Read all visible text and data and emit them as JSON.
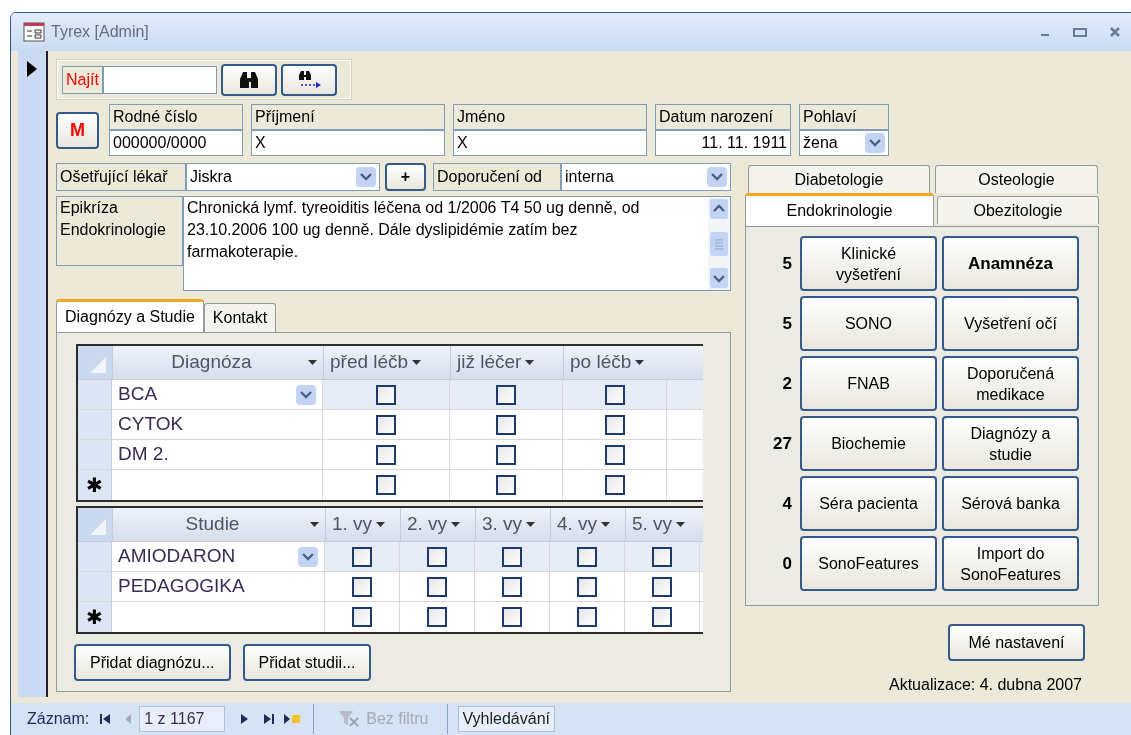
{
  "window": {
    "title": "Tyrex [Admin]"
  },
  "find": {
    "label": "Najít"
  },
  "m_button": {
    "label": "M"
  },
  "patient_fields": [
    {
      "label": "Rodné číslo",
      "value": "000000/0000",
      "kind": "text"
    },
    {
      "label": "Příjmení",
      "value": "X",
      "kind": "text"
    },
    {
      "label": "Jméno",
      "value": "X",
      "kind": "text"
    },
    {
      "label": "Datum narození",
      "value": "11. 11. 1911",
      "kind": "date"
    },
    {
      "label": "Pohlaví",
      "value": "žena",
      "kind": "combo"
    }
  ],
  "doctor": {
    "label": "Ošetřující lékař",
    "value": "Jiskra"
  },
  "plus_button": {
    "label": "+"
  },
  "referral": {
    "label": "Doporučení od",
    "value": "interna"
  },
  "epicrisis": {
    "label": "Epikríza Endokrinologie",
    "text": "Chronická lymf. tyreoiditis léčena od 1/2006 T4 50 ug denně, od 23.10.2006 100 ug denně. Dále dyslipidémie zatím bez farmakoterapie."
  },
  "left_tabs": [
    {
      "label": "Diagnózy a Studie",
      "selected": true
    },
    {
      "label": "Kontakt",
      "selected": false
    }
  ],
  "diagnoses": {
    "columns": [
      "Diagnóza",
      "před léčb",
      "již léčer",
      "po léčb"
    ],
    "new_row_marker": "✱",
    "rows": [
      {
        "name": "BCA",
        "selected": true,
        "checks": [
          false,
          false,
          false
        ]
      },
      {
        "name": "CYTOK",
        "selected": false,
        "checks": [
          false,
          false,
          false
        ]
      },
      {
        "name": "DM 2.",
        "selected": false,
        "checks": [
          false,
          false,
          false
        ]
      }
    ],
    "new_row_checks": [
      false,
      false,
      false
    ]
  },
  "studies": {
    "columns": [
      "Studie",
      "1. vy",
      "2. vy",
      "3. vy",
      "4. vy",
      "5. vy"
    ],
    "new_row_marker": "✱",
    "rows": [
      {
        "name": "AMIODARON",
        "selected": true,
        "checks": [
          false,
          false,
          false,
          false,
          false
        ]
      },
      {
        "name": "PEDAGOGIKA",
        "selected": false,
        "checks": [
          false,
          false,
          false,
          false,
          false
        ]
      }
    ],
    "new_row_checks": [
      false,
      false,
      false,
      false,
      false
    ]
  },
  "grid_buttons": [
    "Přidat diagnózu...",
    "Přidat studii..."
  ],
  "right_tabs": [
    [
      {
        "label": "Diabetologie",
        "selected": false
      },
      {
        "label": "Osteologie",
        "selected": false
      }
    ],
    [
      {
        "label": "Endokrinologie",
        "selected": true
      },
      {
        "label": "Obezitologie",
        "selected": false
      }
    ]
  ],
  "action_rows": [
    {
      "count": "5",
      "left": {
        "label": "Klinické vyšetření",
        "bold": false
      },
      "right": {
        "label": "Anamnéza",
        "bold": true
      }
    },
    {
      "count": "5",
      "left": {
        "label": "SONO",
        "bold": false
      },
      "right": {
        "label": "Vyšetření očí",
        "bold": false
      }
    },
    {
      "count": "2",
      "left": {
        "label": "FNAB",
        "bold": false
      },
      "right": {
        "label": "Doporučená medikace",
        "bold": false
      }
    },
    {
      "count": "27",
      "left": {
        "label": "Biochemie",
        "bold": false
      },
      "right": {
        "label": "Diagnózy a studie",
        "bold": false
      }
    },
    {
      "count": "4",
      "left": {
        "label": "Séra pacienta",
        "bold": false
      },
      "right": {
        "label": "Sérová banka",
        "bold": false
      }
    },
    {
      "count": "0",
      "left": {
        "label": "SonoFeatures",
        "bold": false
      },
      "right": {
        "label": "Import do SonoFeatures",
        "bold": false
      }
    }
  ],
  "settings_button": "Mé nastavení",
  "updated": "Aktualizace: 4. dubna 2007",
  "status_bar": {
    "record_label": "Záznam:",
    "position": "1 z 1167",
    "filter": {
      "label": "Bez filtru",
      "disabled": true
    },
    "search": "Vyhledávání"
  }
}
